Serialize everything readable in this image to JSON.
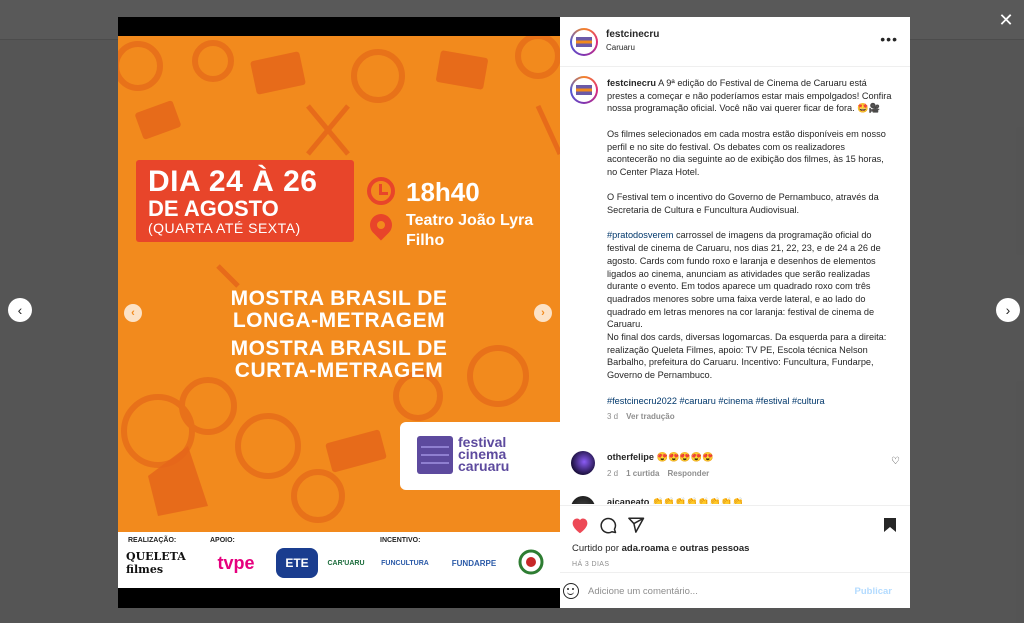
{
  "icons": {
    "close": "✕",
    "prev": "‹",
    "next": "›",
    "more": "•••",
    "heart_small": "♡"
  },
  "colors": {
    "poster_orange": "#f28a1d",
    "poster_red": "#e8452a",
    "festival_purple": "#5d4a9e",
    "like_red": "#ed4956",
    "hashtag_blue": "#00376b",
    "publish_disabled": "#b3dbff"
  },
  "post": {
    "username": "festcinecru",
    "location": "Caruaru"
  },
  "poster": {
    "date_line1": "DIA 24 À 26",
    "date_line2": "DE AGOSTO",
    "date_line3": "(QUARTA ATÉ SEXTA)",
    "time": "18h40",
    "venue": "Teatro João Lyra Filho",
    "mostra_longa": "MOSTRA BRASIL DE LONGA-METRAGEM",
    "mostra_curta": "MOSTRA BRASIL DE CURTA-METRAGEM",
    "logo_text": "festival cinema caruaru",
    "sponsors": {
      "realizacao_label": "REALIZAÇÃO:",
      "apoio_label": "APOIO:",
      "incentivo_label": "INCENTIVO:",
      "queleta": "QUELETA filmes",
      "tvpe": "tvpe",
      "ete": "ETE",
      "caruaru": "CAR'UARU",
      "funcultura": "FUNCULTURA",
      "fundarpe": "FUNDARPE"
    }
  },
  "caption": {
    "username": "festcinecru",
    "p1": "A 9ª edição do Festival de Cinema de Caruaru está prestes a começar e não poderíamos estar mais empolgados! Confira nossa programação oficial. Você não vai querer ficar de fora. 🤩🎥",
    "p2": "Os filmes selecionados em cada mostra estão disponíveis em nosso perfil e no site do festival. Os debates com os realizadores acontecerão no dia seguinte ao de exibição dos filmes, às 15 horas, no Center Plaza Hotel.",
    "p3": "O Festival tem o incentivo do Governo de Pernambuco, através da Secretaria de Cultura e Funcultura Audiovisual.",
    "p4_tag": "#pratodosverem",
    "p4_text": " carrossel de imagens da programação oficial do festival de cinema de Caruaru, nos dias 21, 22, 23, e de 24 a 26 de agosto. Cards com fundo roxo e laranja e desenhos de elementos ligados ao cinema, anunciam as atividades que serão realizadas durante o evento. Em todos aparece um quadrado roxo com três quadrados menores sobre uma faixa verde lateral, e ao lado do quadrado em letras menores na cor laranja: festival de cinema de Caruaru.",
    "p5": "No final dos cards, diversas logomarcas. Da esquerda para a direita: realização Queleta Filmes, apoio: TV PE, Escola técnica Nelson Barbalho, prefeitura do Caruaru. Incentivo: Funcultura, Fundarpe, Governo de Pernambuco.",
    "hashtags": [
      "#festcinecru2022",
      "#caruaru",
      "#cinema",
      "#festival",
      "#cultura"
    ],
    "age": "3 d",
    "translate": "Ver tradução"
  },
  "comments": [
    {
      "username": "otherfelipe",
      "text": "😍😍😍😍😍",
      "age": "2 d",
      "likes": "1 curtida",
      "reply": "Responder"
    },
    {
      "username": "aicaneato",
      "text": "👏👏👏👏👏👏👏👏"
    }
  ],
  "actions": {
    "liked_by_prefix": "Curtido por ",
    "liked_by_user": "ada.roama",
    "liked_by_and": " e ",
    "liked_by_others": "outras pessoas",
    "time_ago": "HÁ 3 DIAS",
    "comment_placeholder": "Adicione um comentário...",
    "publish": "Publicar"
  }
}
